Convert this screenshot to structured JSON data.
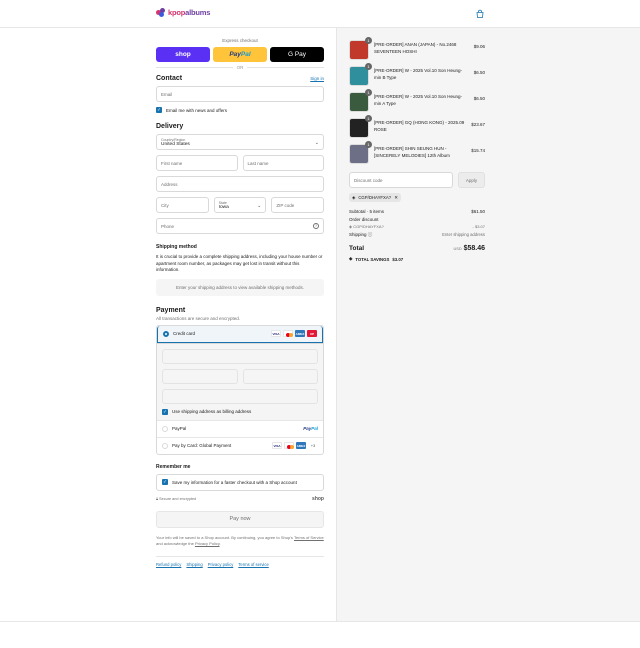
{
  "header": {
    "brand": "kpopalbums",
    "brand_accent": "kpop",
    "brand_rest": "albums",
    "cart_icon": "shopping-bag-icon"
  },
  "express": {
    "label": "Express checkout",
    "shop_label": "shop",
    "paypal_label_a": "Pay",
    "paypal_label_b": "Pal",
    "gpay_label": "G Pay",
    "or": "OR"
  },
  "contact": {
    "heading": "Contact",
    "signin": "Sign in",
    "email_placeholder": "Email",
    "news_label": "Email me with news and offers"
  },
  "delivery": {
    "heading": "Delivery",
    "country_label": "Country/Region",
    "country_value": "United States",
    "first_name": "First name",
    "last_name": "Last name",
    "address": "Address",
    "city": "City",
    "state_label": "State",
    "state_value": "Iowa",
    "zip": "ZIP code",
    "phone": "Phone"
  },
  "shipping": {
    "heading": "Shipping method",
    "note": "It is crucial to provide a complete shipping address, including your house number or apartment room number, as packages may get lost in transit without this information.",
    "notice": "Enter your shipping address to view available shipping methods."
  },
  "payment": {
    "heading": "Payment",
    "subtitle": "All transactions are secure and encrypted.",
    "credit_card": "Credit card",
    "billing_label": "Use shipping address as billing address",
    "paypal": "PayPal",
    "global": "Pay by Card: Global Payment",
    "more_cards": "+3",
    "card_visa": "VISA",
    "card_amex": "AMEX",
    "card_union": "UP"
  },
  "remember": {
    "heading": "Remember me",
    "save_label": "Save my information for a faster checkout with a Shop account",
    "secure": "Secure and encrypted",
    "shop": "shop"
  },
  "paynow": "Pay now",
  "legal": {
    "text_a": "Your info will be saved to a Shop account. By continuing, you agree to Shop's",
    "terms": "Terms of Service",
    "text_b": "and acknowledge the",
    "privacy": "Privacy Policy",
    "text_c": "."
  },
  "footer": [
    "Refund policy",
    "Shipping",
    "Privacy policy",
    "Terms of service"
  ],
  "cart": {
    "items": [
      {
        "name": "[PRE-ORDER] ANAN (JAPAN) - No.2468 SEVENTEEN HOSHI",
        "price": "$9.06",
        "qty": "1",
        "color": "#c0392b"
      },
      {
        "name": "[PRE-ORDER] W - 2025 Vol.10 Son Heung-min B Type",
        "price": "$6.50",
        "qty": "1",
        "color": "#2f8f9d"
      },
      {
        "name": "[PRE-ORDER] W - 2025 Vol.10 Son Heung-min A Type",
        "price": "$6.50",
        "qty": "1",
        "color": "#3b5b3e"
      },
      {
        "name": "[PRE-ORDER] GQ (HONG KONG) - 2025.09 ROSE",
        "price": "$23.67",
        "qty": "1",
        "color": "#222222"
      },
      {
        "name": "[PRE-ORDER] SHIN SEUNG HUN - [SINCERELY MELODIES] 12th Album",
        "price": "$15.74",
        "qty": "1",
        "color": "#6c6f86"
      }
    ],
    "discount_placeholder": "Discount code",
    "apply": "Apply",
    "code": "CGP/DHAYFXA?",
    "subtotal_label": "Subtotal · 5 items",
    "subtotal": "$61.50",
    "order_discount": "Order discount",
    "discount_code": "CGP/DHAYFXA?",
    "discount_amount": "- $3.07",
    "shipping_label": "Shipping",
    "shipping_value": "Enter shipping address",
    "total_label": "Total",
    "currency": "USD",
    "total": "$58.46",
    "savings_label": "TOTAL SAVINGS",
    "savings": "$3.07"
  }
}
